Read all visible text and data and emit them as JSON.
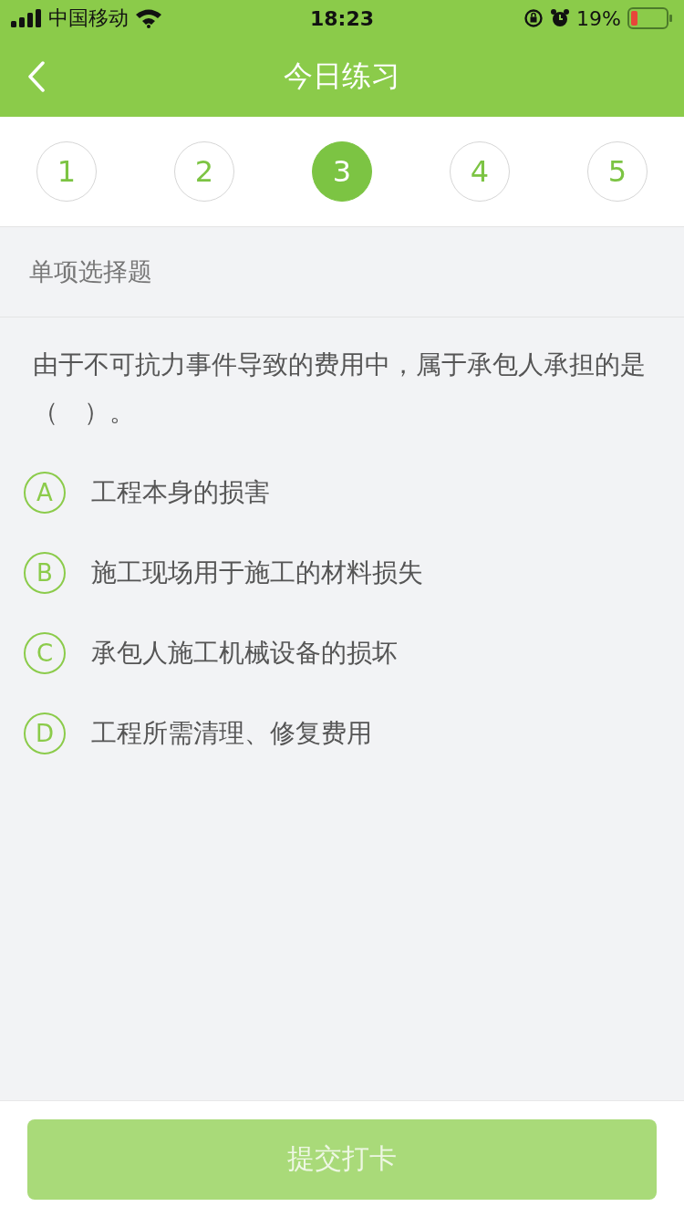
{
  "status_bar": {
    "carrier": "中国移动",
    "time": "18:23",
    "battery": "19%"
  },
  "nav": {
    "title": "今日练习"
  },
  "questions": [
    {
      "label": "1",
      "selected": false
    },
    {
      "label": "2",
      "selected": false
    },
    {
      "label": "3",
      "selected": true
    },
    {
      "label": "4",
      "selected": false
    },
    {
      "label": "5",
      "selected": false
    }
  ],
  "section_title": "单项选择题",
  "question": "由于不可抗力事件导致的费用中，属于承包人承担的是（　）。",
  "options": [
    {
      "letter": "A",
      "text": "工程本身的损害",
      "selected": false
    },
    {
      "letter": "B",
      "text": "施工现场用于施工的材料损失",
      "selected": false
    },
    {
      "letter": "C",
      "text": "承包人施工机械设备的损坏",
      "selected": false
    },
    {
      "letter": "D",
      "text": "工程所需清理、修复费用",
      "selected": false
    }
  ],
  "submit": {
    "label": "提交打卡",
    "disabled": true
  }
}
